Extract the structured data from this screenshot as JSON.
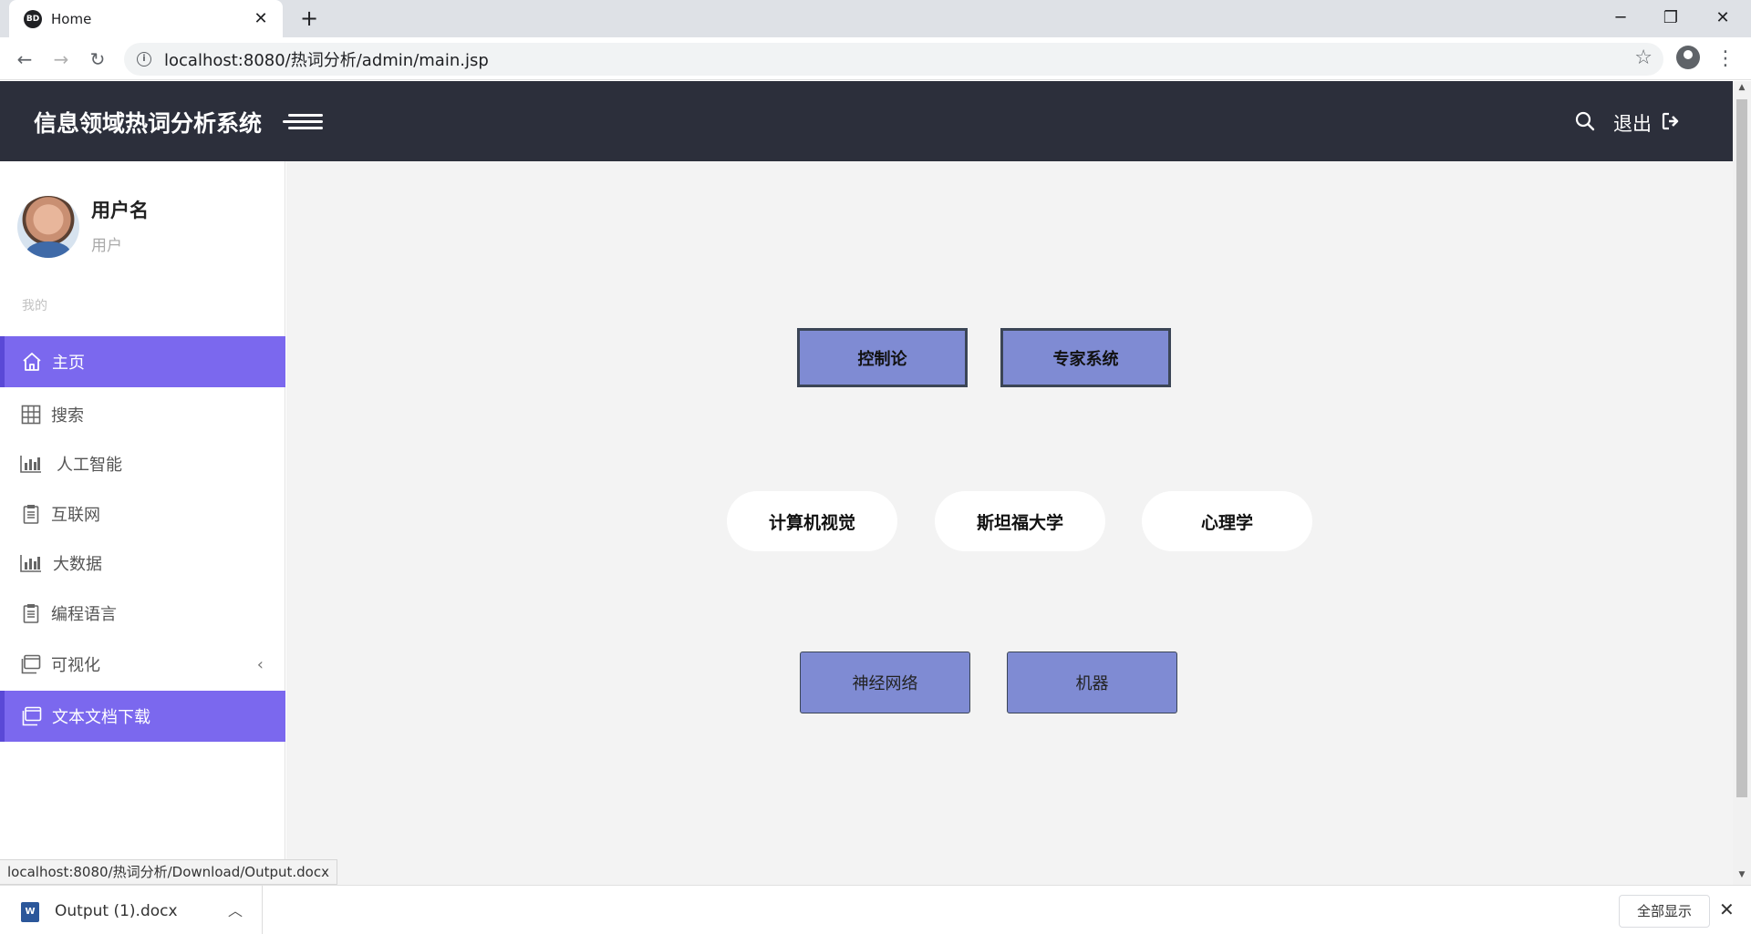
{
  "browser": {
    "tab_title": "Home",
    "tab_favicon_text": "BD",
    "tab_close": "✕",
    "new_tab": "+",
    "url": "localhost:8080/热词分析/admin/main.jsp",
    "window_controls": [
      "─",
      "❐",
      "✕"
    ]
  },
  "header": {
    "title": "信息领域热词分析系统",
    "logout_label": "退出"
  },
  "user": {
    "name": "用户名",
    "role": "用户"
  },
  "sidebar": {
    "section_label": "我的",
    "items": [
      {
        "label": "主页",
        "icon": "home-icon",
        "active": true
      },
      {
        "label": "搜索",
        "icon": "grid-icon",
        "active": false
      },
      {
        "label": "人工智能",
        "icon": "bar-chart-icon",
        "active": false
      },
      {
        "label": "互联网",
        "icon": "clipboard-icon",
        "active": false
      },
      {
        "label": "大数据",
        "icon": "bar-chart-icon",
        "active": false
      },
      {
        "label": "编程语言",
        "icon": "clipboard-icon",
        "active": false
      },
      {
        "label": "可视化",
        "icon": "window-icon",
        "active": false,
        "chevron": "‹"
      },
      {
        "label": "文本文档下载",
        "icon": "window-icon",
        "active": true
      }
    ]
  },
  "topics": {
    "row1": [
      "控制论",
      "专家系统"
    ],
    "row2": [
      "计算机视觉",
      "斯坦福大学",
      "心理学"
    ],
    "row3": [
      "神经网络",
      "机器"
    ]
  },
  "status_url": "localhost:8080/热词分析/Download/Output.docx",
  "downloads": {
    "file_name": "Output (1).docx",
    "show_all": "全部显示"
  },
  "colors": {
    "header_bg": "#2c2f3b",
    "accent": "#7b68ee",
    "topic_fill": "#7f8bd3",
    "main_bg": "#f3f3f3"
  }
}
